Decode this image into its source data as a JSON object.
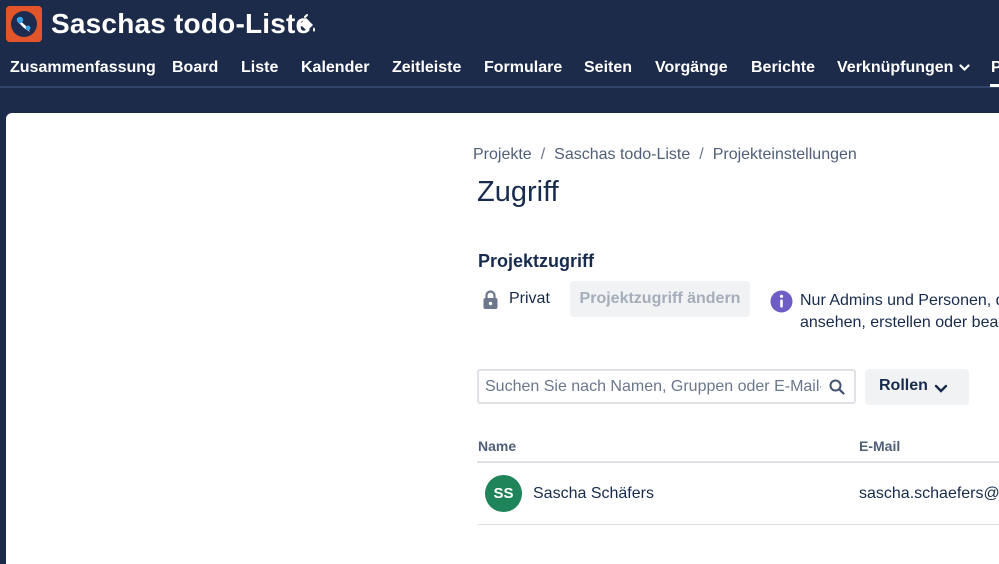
{
  "project": {
    "title": "Saschas todo-Liste"
  },
  "tabs": [
    {
      "label": "Zusammenfassung"
    },
    {
      "label": "Board"
    },
    {
      "label": "Liste"
    },
    {
      "label": "Kalender"
    },
    {
      "label": "Zeitleiste"
    },
    {
      "label": "Formulare"
    },
    {
      "label": "Seiten"
    },
    {
      "label": "Vorgänge"
    },
    {
      "label": "Berichte"
    },
    {
      "label": "Verknüpfungen"
    },
    {
      "label": "P"
    }
  ],
  "breadcrumb": [
    {
      "label": "Projekte"
    },
    {
      "label": "Saschas todo-Liste"
    },
    {
      "label": "Projekteinstellungen"
    }
  ],
  "breadcrumb_separator": "/",
  "page": {
    "title": "Zugriff"
  },
  "access": {
    "heading": "Projektzugriff",
    "privacy_label": "Privat",
    "change_button": "Projektzugriff ändern",
    "info_line1": "Nur Admins und Personen, d",
    "info_line2": "ansehen, erstellen oder bearb"
  },
  "search": {
    "placeholder": "Suchen Sie nach Namen, Gruppen oder E-Mail-Adressen",
    "value": ""
  },
  "roles_button": "Rollen",
  "table": {
    "columns": {
      "name": "Name",
      "email": "E-Mail"
    },
    "rows": [
      {
        "initials": "SS",
        "name": "Sascha Schäfers",
        "email": "sascha.schaefers@el"
      }
    ]
  },
  "colors": {
    "topbar": "#1c2b4a",
    "logo": "#e2552a",
    "avatar": "#1f845a",
    "info": "#6e5dc6"
  },
  "icons": {
    "logo": "project-logo-icon",
    "theme": "paint-bucket-icon",
    "lock": "lock-icon",
    "info": "info-icon",
    "search": "search-icon",
    "chevron": "chevron-down-icon"
  }
}
